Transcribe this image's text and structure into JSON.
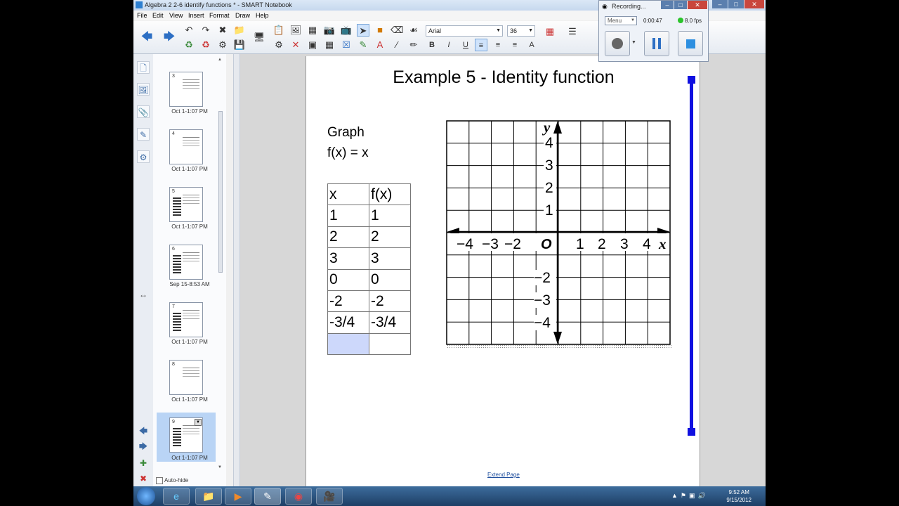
{
  "window": {
    "title": "Algebra 2 2-6 identify functions * - SMART Notebook"
  },
  "menu": [
    "File",
    "Edit",
    "View",
    "Insert",
    "Format",
    "Draw",
    "Help"
  ],
  "toolbar": {
    "font_name": "Arial",
    "font_size": "36",
    "bold": "B",
    "italic": "I",
    "underline": "U"
  },
  "recorder": {
    "title": "Recording...",
    "menu_label": "Menu",
    "elapsed": "0:00:47",
    "fps": "8.0 fps"
  },
  "sorter": {
    "pages": [
      {
        "num": "3",
        "time": "Oct 1-1:07 PM"
      },
      {
        "num": "4",
        "time": "Oct 1-1:07 PM"
      },
      {
        "num": "5",
        "time": "Oct 1-1:07 PM"
      },
      {
        "num": "6",
        "time": "Sep 15-8:53 AM"
      },
      {
        "num": "7",
        "time": "Oct 1-1:07 PM"
      },
      {
        "num": "8",
        "time": "Oct 1-1:07 PM"
      },
      {
        "num": "9",
        "time": "Oct 1-1:07 PM"
      }
    ],
    "autohide": "Auto-hide"
  },
  "page": {
    "heading": "Example 5 - Identity function",
    "graph_line1": "Graph",
    "graph_line2": "f(x) = x",
    "table": {
      "headers": [
        "x",
        "f(x)"
      ],
      "rows": [
        [
          "1",
          "1"
        ],
        [
          "2",
          "2"
        ],
        [
          "3",
          "3"
        ],
        [
          "0",
          "0"
        ],
        [
          "-2",
          "-2"
        ],
        [
          "-3/4",
          "-3/4"
        ],
        [
          "",
          ""
        ]
      ]
    },
    "grid": {
      "x_label": "x",
      "y_label": "y",
      "origin": "O",
      "x_ticks": [
        "−4",
        "−3",
        "−2",
        "1",
        "2",
        "3",
        "4"
      ],
      "y_ticks": [
        "4",
        "3",
        "2",
        "1",
        "−2",
        "−3",
        "−4"
      ]
    },
    "extend_link": "Extend Page"
  },
  "clock": {
    "time": "9:52 AM",
    "date": "9/15/2012"
  }
}
